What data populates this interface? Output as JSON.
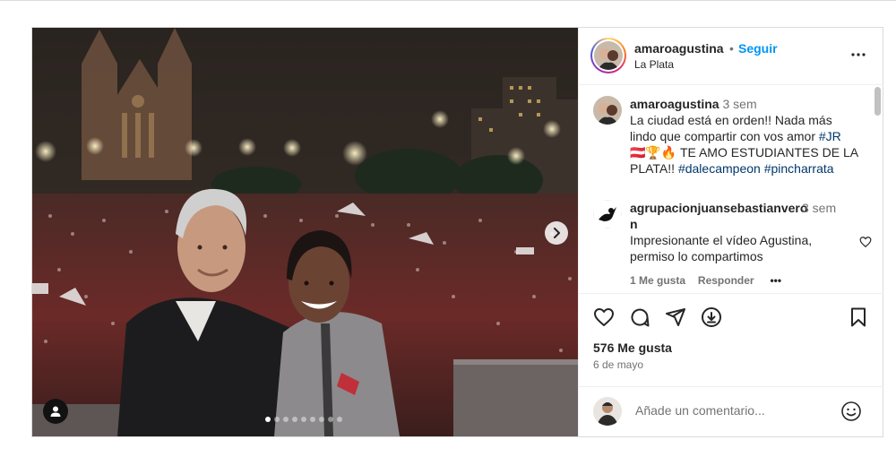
{
  "post": {
    "username": "amaroagustina",
    "separator": "•",
    "follow_label": "Seguir",
    "location": "La Plata",
    "carousel": {
      "total_slides": 9,
      "active_slide": 1
    }
  },
  "caption": {
    "username": "amaroagustina",
    "time": "3 sem",
    "text_before": "La ciudad está en orden!! Nada más lindo que compartir con vos amor ",
    "tag1": "#JR",
    "emojis": " 🇦🇹🏆🔥 ",
    "text_after": "TE AMO ESTUDIANTES DE LA PLATA!! ",
    "tag2": "#dalecampeon",
    "space": " ",
    "tag3": "#pincharrata"
  },
  "comment": {
    "username": "agrupacionjuansebastianveron",
    "time": "3 sem",
    "text": "Impresionante el vídeo Agustina, permiso lo compartimos",
    "likes_label": "1 Me gusta",
    "reply_label": "Responder",
    "more_label": "•••"
  },
  "actions": {
    "likes": "576 Me gusta",
    "date": "6 de mayo"
  },
  "add_comment": {
    "placeholder": "Añade un comentario..."
  },
  "icons": {
    "like": "heart-icon",
    "comment": "comment-icon",
    "share": "share-icon",
    "save_download": "download-icon",
    "bookmark": "bookmark-icon",
    "emoji": "emoji-icon",
    "more": "more-icon",
    "next": "chevron-right-icon",
    "tag": "user-tag-icon"
  },
  "colors": {
    "link_blue": "#0095f6",
    "hashtag": "#00376b",
    "muted": "#737373",
    "border": "#dbdbdb"
  }
}
